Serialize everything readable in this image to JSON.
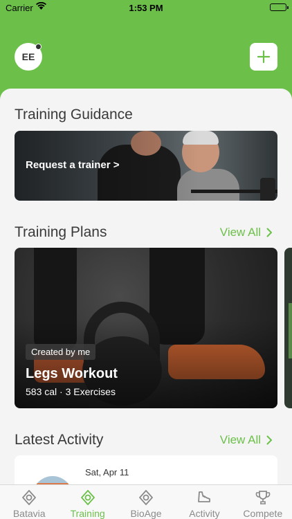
{
  "status_bar": {
    "carrier": "Carrier",
    "time": "1:53 PM"
  },
  "header": {
    "avatar_initials": "EE"
  },
  "training_guidance": {
    "title": "Training Guidance",
    "card_label": "Request a trainer >"
  },
  "training_plans": {
    "title": "Training Plans",
    "view_all": "View All",
    "plans": [
      {
        "badge": "Created by me",
        "title": "Legs Workout",
        "meta": "583 cal · 3 Exercises"
      }
    ]
  },
  "latest_activity": {
    "title": "Latest Activity",
    "view_all": "View All",
    "items": [
      {
        "date": "Sat, Apr 11"
      }
    ]
  },
  "tabs": [
    {
      "label": "Batavia",
      "icon": "location-pin-icon",
      "active": false
    },
    {
      "label": "Training",
      "icon": "location-pin-icon",
      "active": true
    },
    {
      "label": "BioAge",
      "icon": "location-pin-icon",
      "active": false
    },
    {
      "label": "Activity",
      "icon": "running-shoe-icon",
      "active": false
    },
    {
      "label": "Compete",
      "icon": "trophy-icon",
      "active": false
    }
  ],
  "colors": {
    "accent": "#6cc04a",
    "inactive": "#8a8a8a"
  }
}
